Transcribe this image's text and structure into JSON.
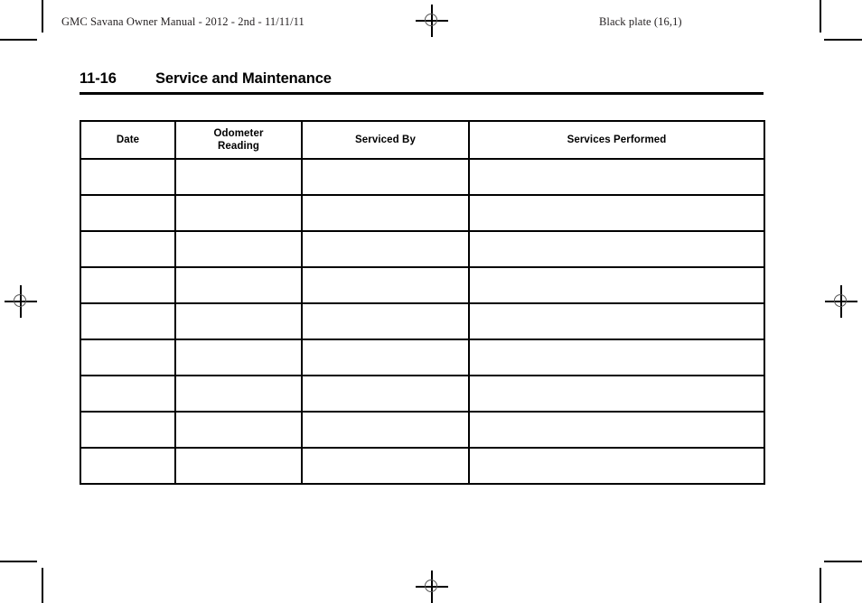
{
  "document": {
    "running_head_left": "GMC Savana Owner Manual - 2012 - 2nd - 11/11/11",
    "running_head_right": "Black plate (16,1)"
  },
  "page": {
    "number": "11-16",
    "title": "Service and Maintenance"
  },
  "table": {
    "headers": [
      {
        "lines": [
          "Date"
        ]
      },
      {
        "lines": [
          "Odometer",
          "Reading"
        ]
      },
      {
        "lines": [
          "Serviced By"
        ]
      },
      {
        "lines": [
          "Services Performed"
        ]
      }
    ],
    "rows": [
      [
        "",
        "",
        "",
        ""
      ],
      [
        "",
        "",
        "",
        ""
      ],
      [
        "",
        "",
        "",
        ""
      ],
      [
        "",
        "",
        "",
        ""
      ],
      [
        "",
        "",
        "",
        ""
      ],
      [
        "",
        "",
        "",
        ""
      ],
      [
        "",
        "",
        "",
        ""
      ],
      [
        "",
        "",
        "",
        ""
      ],
      [
        "",
        "",
        "",
        ""
      ]
    ]
  },
  "colors": {
    "ink": "#000000",
    "running_head_ink": "#231f20",
    "registration_mark": "#555555",
    "paper": "#ffffff"
  }
}
